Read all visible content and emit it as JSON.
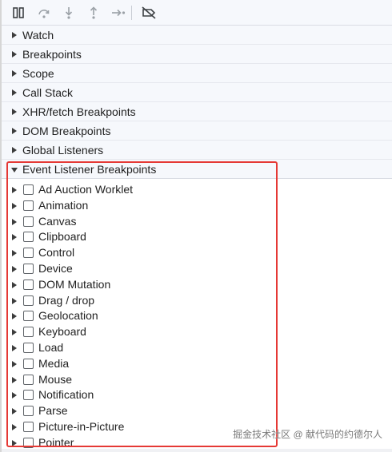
{
  "toolbar": {
    "buttons": [
      {
        "icon": "pause-icon"
      },
      {
        "icon": "step-over-icon"
      },
      {
        "icon": "step-into-icon"
      },
      {
        "icon": "step-out-icon"
      },
      {
        "icon": "step-icon"
      },
      {
        "icon": "deactivate-breakpoints-icon"
      }
    ]
  },
  "sections": [
    {
      "label": "Watch",
      "expanded": false
    },
    {
      "label": "Breakpoints",
      "expanded": false
    },
    {
      "label": "Scope",
      "expanded": false
    },
    {
      "label": "Call Stack",
      "expanded": false
    },
    {
      "label": "XHR/fetch Breakpoints",
      "expanded": false
    },
    {
      "label": "DOM Breakpoints",
      "expanded": false
    },
    {
      "label": "Global Listeners",
      "expanded": false
    },
    {
      "label": "Event Listener Breakpoints",
      "expanded": true
    }
  ],
  "event_categories": [
    {
      "label": "Ad Auction Worklet",
      "checked": false
    },
    {
      "label": "Animation",
      "checked": false
    },
    {
      "label": "Canvas",
      "checked": false
    },
    {
      "label": "Clipboard",
      "checked": false
    },
    {
      "label": "Control",
      "checked": false
    },
    {
      "label": "Device",
      "checked": false
    },
    {
      "label": "DOM Mutation",
      "checked": false
    },
    {
      "label": "Drag / drop",
      "checked": false
    },
    {
      "label": "Geolocation",
      "checked": false
    },
    {
      "label": "Keyboard",
      "checked": false
    },
    {
      "label": "Load",
      "checked": false
    },
    {
      "label": "Media",
      "checked": false
    },
    {
      "label": "Mouse",
      "checked": false
    },
    {
      "label": "Notification",
      "checked": false
    },
    {
      "label": "Parse",
      "checked": false
    },
    {
      "label": "Picture-in-Picture",
      "checked": false
    },
    {
      "label": "Pointer",
      "checked": false
    }
  ],
  "watermark": "掘金技术社区 @ 献代码的约德尔人",
  "colors": {
    "highlight": "#e53935",
    "panel_bg": "#f6f8fc",
    "icon": "#5f6368"
  }
}
